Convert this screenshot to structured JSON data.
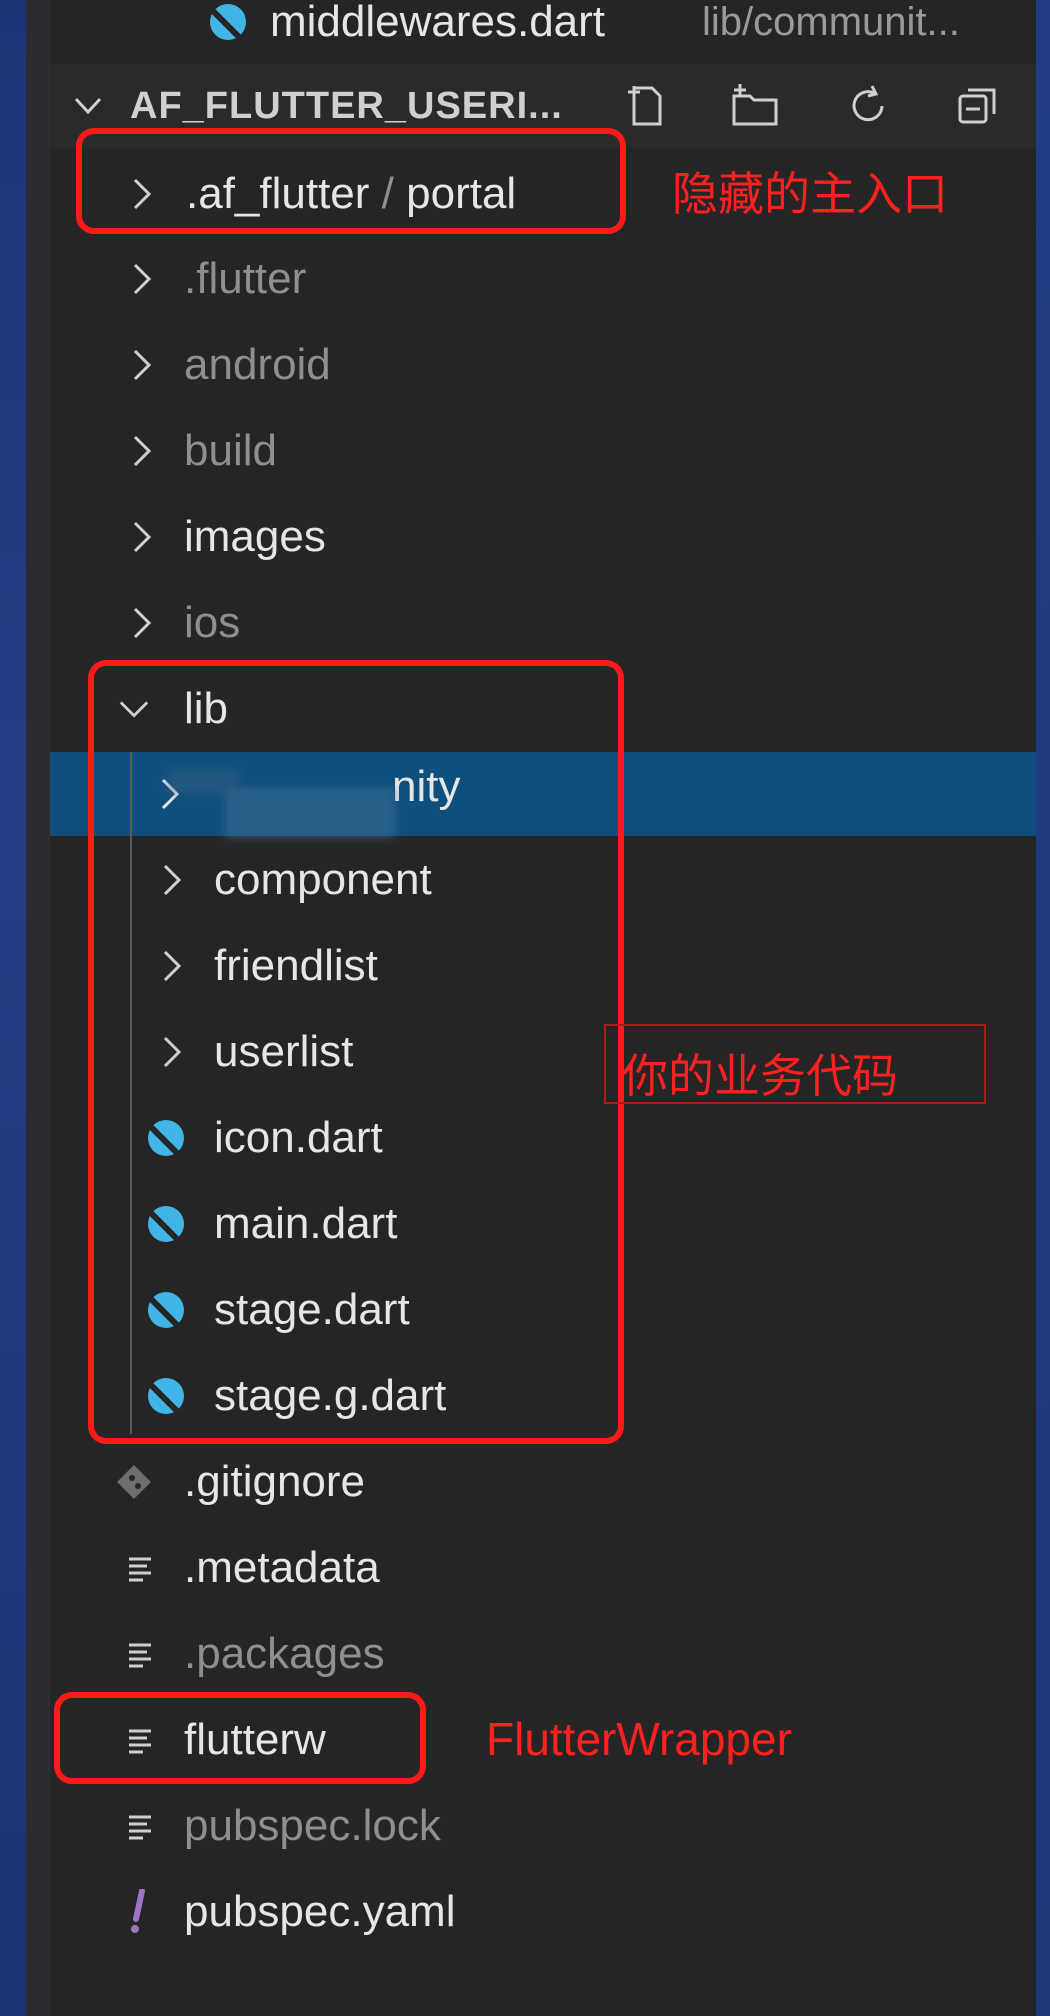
{
  "top_file": {
    "name": "middlewares.dart",
    "path": "lib/communit..."
  },
  "header": {
    "title": "AF_FLUTTER_USERI...",
    "actions": [
      "new-file-icon",
      "new-folder-icon",
      "refresh-icon",
      "collapse-all-icon"
    ]
  },
  "tree": {
    "af_flutter_name": ".af_flutter",
    "af_flutter_sep": " / ",
    "af_flutter_child": "portal",
    "flutter": ".flutter",
    "android": "android",
    "build": "build",
    "images": "images",
    "ios": "ios",
    "lib": "lib",
    "lib_selected": "nity",
    "component": "component",
    "friendlist": "friendlist",
    "userlist": "userlist",
    "icon_dart": "icon.dart",
    "main_dart": "main.dart",
    "stage_dart": "stage.dart",
    "stage_g_dart": "stage.g.dart",
    "gitignore": ".gitignore",
    "metadata": ".metadata",
    "packages": ".packages",
    "flutterw": "flutterw",
    "pubspec_lock": "pubspec.lock",
    "pubspec_yaml": "pubspec.yaml"
  },
  "annotations": {
    "hidden_entry": "隐藏的主入口",
    "business_code": "你的业务代码",
    "flutter_wrapper": "FlutterWrapper"
  },
  "colors": {
    "panel_bg": "#252526",
    "selected_bg": "#0f4f7e",
    "annotation": "#ff1a1a",
    "dart_icon": "#41b6e6",
    "yaml_icon": "#a074c4"
  }
}
